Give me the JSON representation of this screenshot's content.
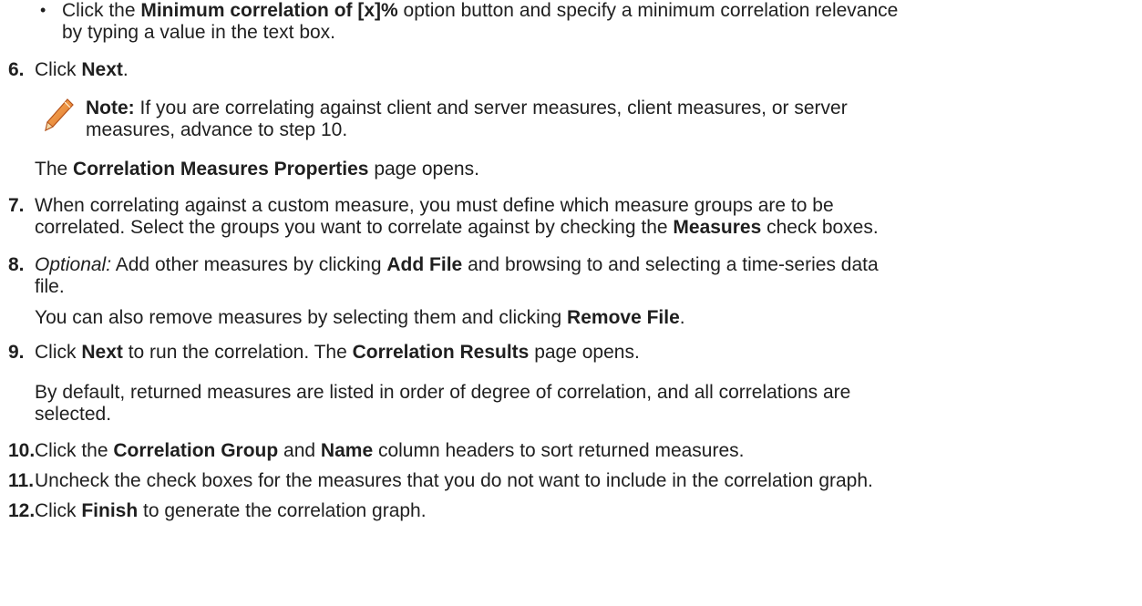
{
  "bullet": {
    "line1_pre": "Click the ",
    "line1_bold": "Minimum correlation of [x]%",
    "line1_post": " option button and specify a minimum correlation relevance",
    "line2": "by typing a value in the text box."
  },
  "step6": {
    "number": "6.",
    "pre": "Click ",
    "bold": "Next",
    "post": "."
  },
  "note": {
    "icon": "pencil-icon",
    "label": "Note:",
    "line1": " If you are correlating against client and server measures, client measures, or server",
    "line2": "measures, advance to step 10."
  },
  "after_note": {
    "pre": "The ",
    "bold": "Correlation Measures Properties",
    "post": " page opens."
  },
  "step7": {
    "number": "7.",
    "line1": "When correlating against a custom measure, you must define which measure groups are to be",
    "line2_pre": "correlated. Select the groups you want to correlate against by checking the ",
    "line2_bold": "Measures",
    "line2_post": " check boxes."
  },
  "step8": {
    "number": "8.",
    "italic": "Optional:",
    "line1_pre": " Add other measures by clicking ",
    "line1_bold": "Add File",
    "line1_post": " and browsing to and selecting a time-series data",
    "line2": "file.",
    "extra_pre": "You can also remove measures by selecting them and clicking ",
    "extra_bold": "Remove File",
    "extra_post": "."
  },
  "step9": {
    "number": "9.",
    "pre": "Click ",
    "bold1": "Next",
    "mid": " to run the correlation. The ",
    "bold2": "Correlation Results",
    "post": " page opens.",
    "extra_line1": "By default, returned measures are listed in order of degree of correlation, and all correlations are",
    "extra_line2": "selected."
  },
  "step10": {
    "number": "10.",
    "pre": "Click the ",
    "bold1": "Correlation Group",
    "mid": " and ",
    "bold2": "Name",
    "post": " column headers to sort returned measures."
  },
  "step11": {
    "number": "11.",
    "text": "Uncheck the check boxes for the measures that you do not want to include in the correlation graph."
  },
  "step12": {
    "number": "12.",
    "pre": "Click ",
    "bold": "Finish",
    "post": " to generate the correlation graph."
  }
}
